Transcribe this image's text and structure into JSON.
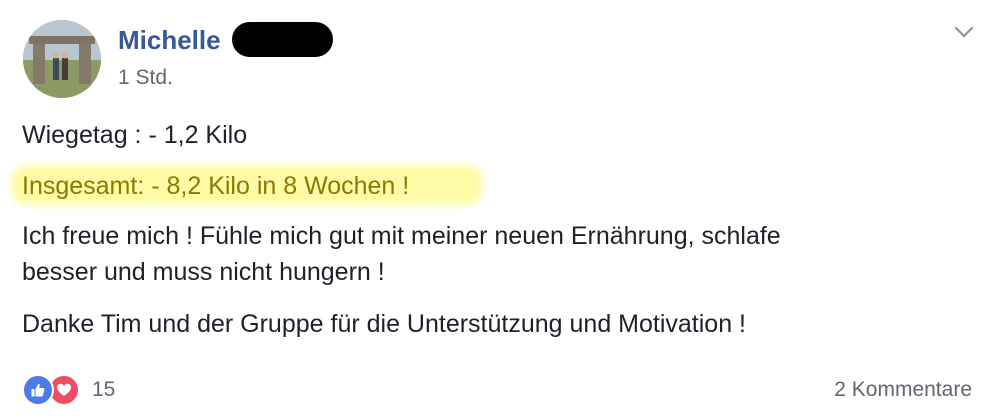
{
  "post": {
    "author": "Michelle",
    "timestamp": "1 Std.",
    "lines": [
      "Wiegetag : - 1,2 Kilo",
      "Insgesamt: - 8,2 Kilo in 8 Wochen !",
      "Ich freue mich ! Fühle mich gut mit meiner neuen Ernährung, schlafe",
      "besser und muss nicht hungern !",
      "Danke Tim und der Gruppe für die Unterstützung und Motivation !"
    ],
    "highlight_color": "#fdfb9c"
  },
  "footer": {
    "reaction_icons": [
      "like-icon",
      "love-icon"
    ],
    "reaction_count": "15",
    "comments_label": "2 Kommentare"
  },
  "colors": {
    "author_link": "#385898",
    "meta_text": "#616770",
    "body_text": "#1d2129",
    "like": "#4a7be8",
    "love": "#ef4d65"
  }
}
